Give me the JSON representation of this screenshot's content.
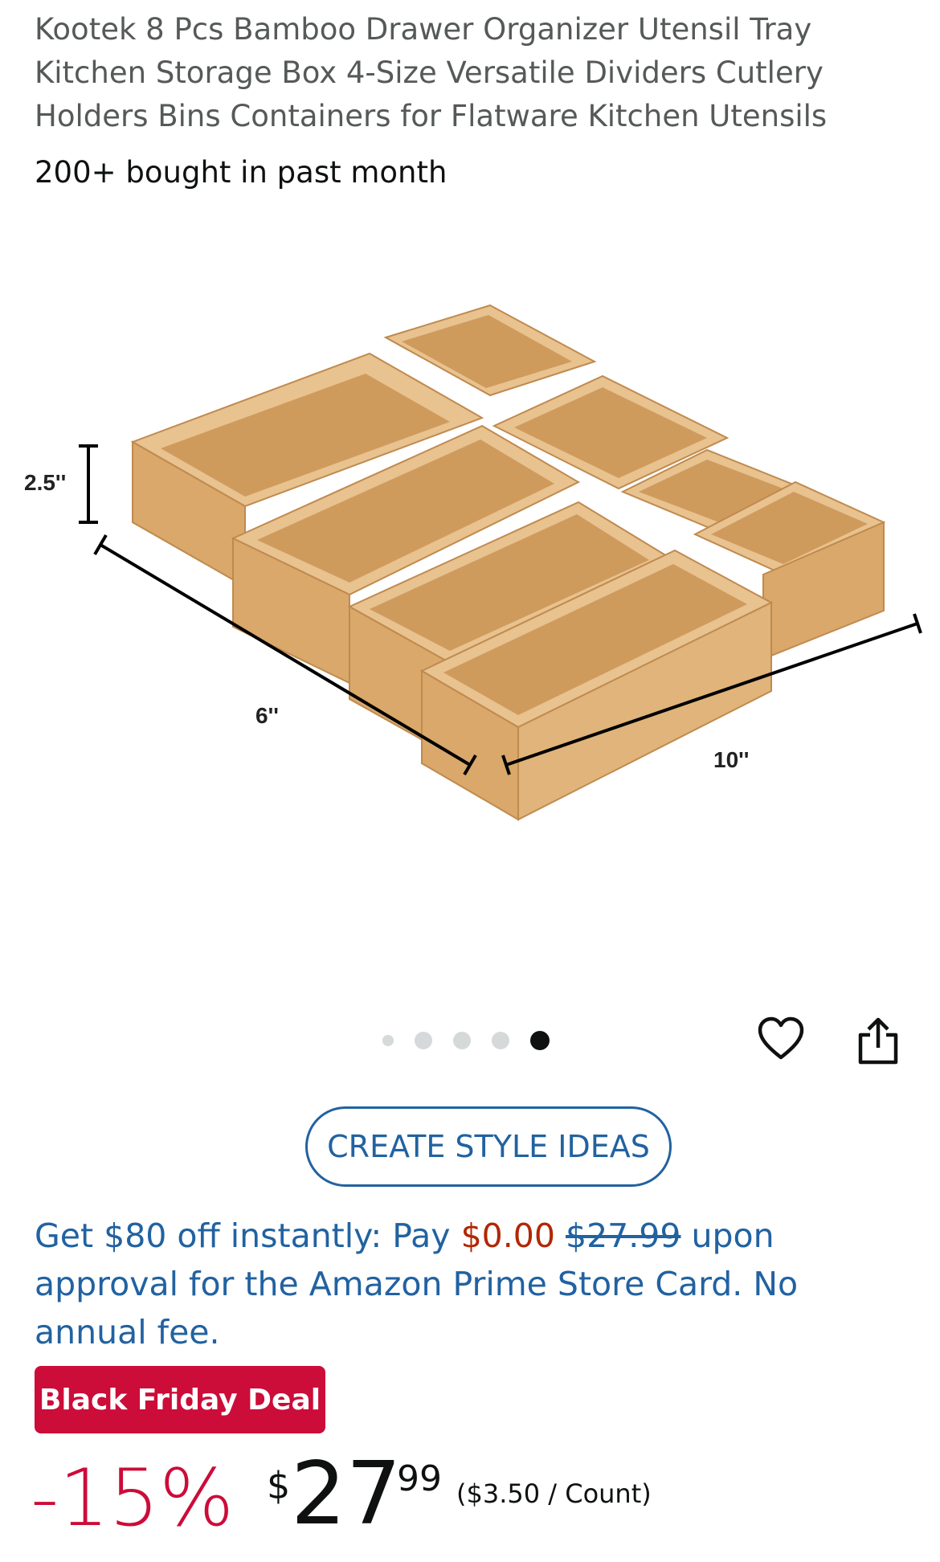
{
  "product": {
    "title": "Kootek 8 Pcs Bamboo Drawer Organizer Utensil Tray Kitchen Storage Box 4-Size Versatile Dividers Cutlery Holders Bins Containers for Flatware Kitchen Utensils",
    "social_proof": "200+ bought in past month"
  },
  "image": {
    "dimension_labels": {
      "height": "2.5''",
      "depth": "6''",
      "width": "10''"
    },
    "wood_colors": {
      "light": "#e8c28f",
      "mid": "#d9a86a",
      "dark": "#c08a4e",
      "inner": "#cf9b5d"
    }
  },
  "carousel": {
    "total": 5,
    "active_index": 4
  },
  "actions": {
    "wishlist_icon": "heart-icon",
    "share_icon": "share-icon"
  },
  "style_button": {
    "label": "CREATE STYLE IDEAS"
  },
  "card_offer": {
    "part1": "Get $80 off instantly: Pay ",
    "pay_amount": "$0.00",
    "space": " ",
    "original": "$27.99",
    "part2": " upon approval for the Amazon Prime Store Card. No annual fee."
  },
  "deal": {
    "badge": "Black Friday Deal"
  },
  "price": {
    "discount": "-15%",
    "currency": "$",
    "whole": "27",
    "fraction": "99",
    "per_unit": "($3.50 / Count)"
  },
  "colors": {
    "link": "#2162a1",
    "deal_red": "#cc0c39",
    "price_red": "#b12704",
    "text": "#0f1111",
    "muted": "#565959"
  }
}
